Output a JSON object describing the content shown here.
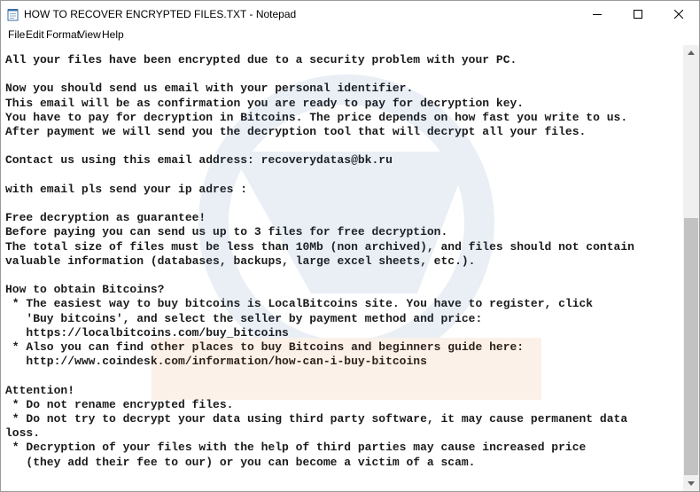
{
  "window": {
    "title": "HOW TO RECOVER ENCRYPTED FILES.TXT - Notepad",
    "app_icon": "notepad-icon",
    "controls": [
      "minimize-icon",
      "maximize-icon",
      "close-icon"
    ]
  },
  "menu": {
    "file": "File",
    "edit": "Edit",
    "format": "Format",
    "view": "View",
    "help": "Help"
  },
  "document": {
    "lines": [
      "All your files have been encrypted due to a security problem with your PC.",
      "",
      "Now you should send us email with your personal identifier.",
      "This email will be as confirmation you are ready to pay for decryption key.",
      "You have to pay for decryption in Bitcoins. The price depends on how fast you write to us.",
      "After payment we will send you the decryption tool that will decrypt all your files.",
      "",
      "Contact us using this email address: recoverydatas@bk.ru",
      "",
      "with email pls send your ip adres :",
      "",
      "Free decryption as guarantee!",
      "Before paying you can send us up to 3 files for free decryption.",
      "The total size of files must be less than 10Mb (non archived), and files should not contain",
      "valuable information (databases, backups, large excel sheets, etc.).",
      "",
      "How to obtain Bitcoins?",
      " * The easiest way to buy bitcoins is LocalBitcoins site. You have to register, click",
      "   'Buy bitcoins', and select the seller by payment method and price:",
      "   https://localbitcoins.com/buy_bitcoins",
      " * Also you can find other places to buy Bitcoins and beginners guide here:",
      "   http://www.coindesk.com/information/how-can-i-buy-bitcoins",
      "",
      "Attention!",
      " * Do not rename encrypted files.",
      " * Do not try to decrypt your data using third party software, it may cause permanent data",
      "loss.",
      " * Decryption of your files with the help of third parties may cause increased price",
      "   (they add their fee to our) or you can become a victim of a scam."
    ]
  },
  "scrollbar": {
    "icons": [
      "scroll-up-arrow-icon",
      "scroll-down-arrow-icon"
    ]
  },
  "colors": {
    "text": "#1a1a1a",
    "scroll_thumb": "#c2c2c2",
    "scroll_track": "#f0f0f0"
  }
}
